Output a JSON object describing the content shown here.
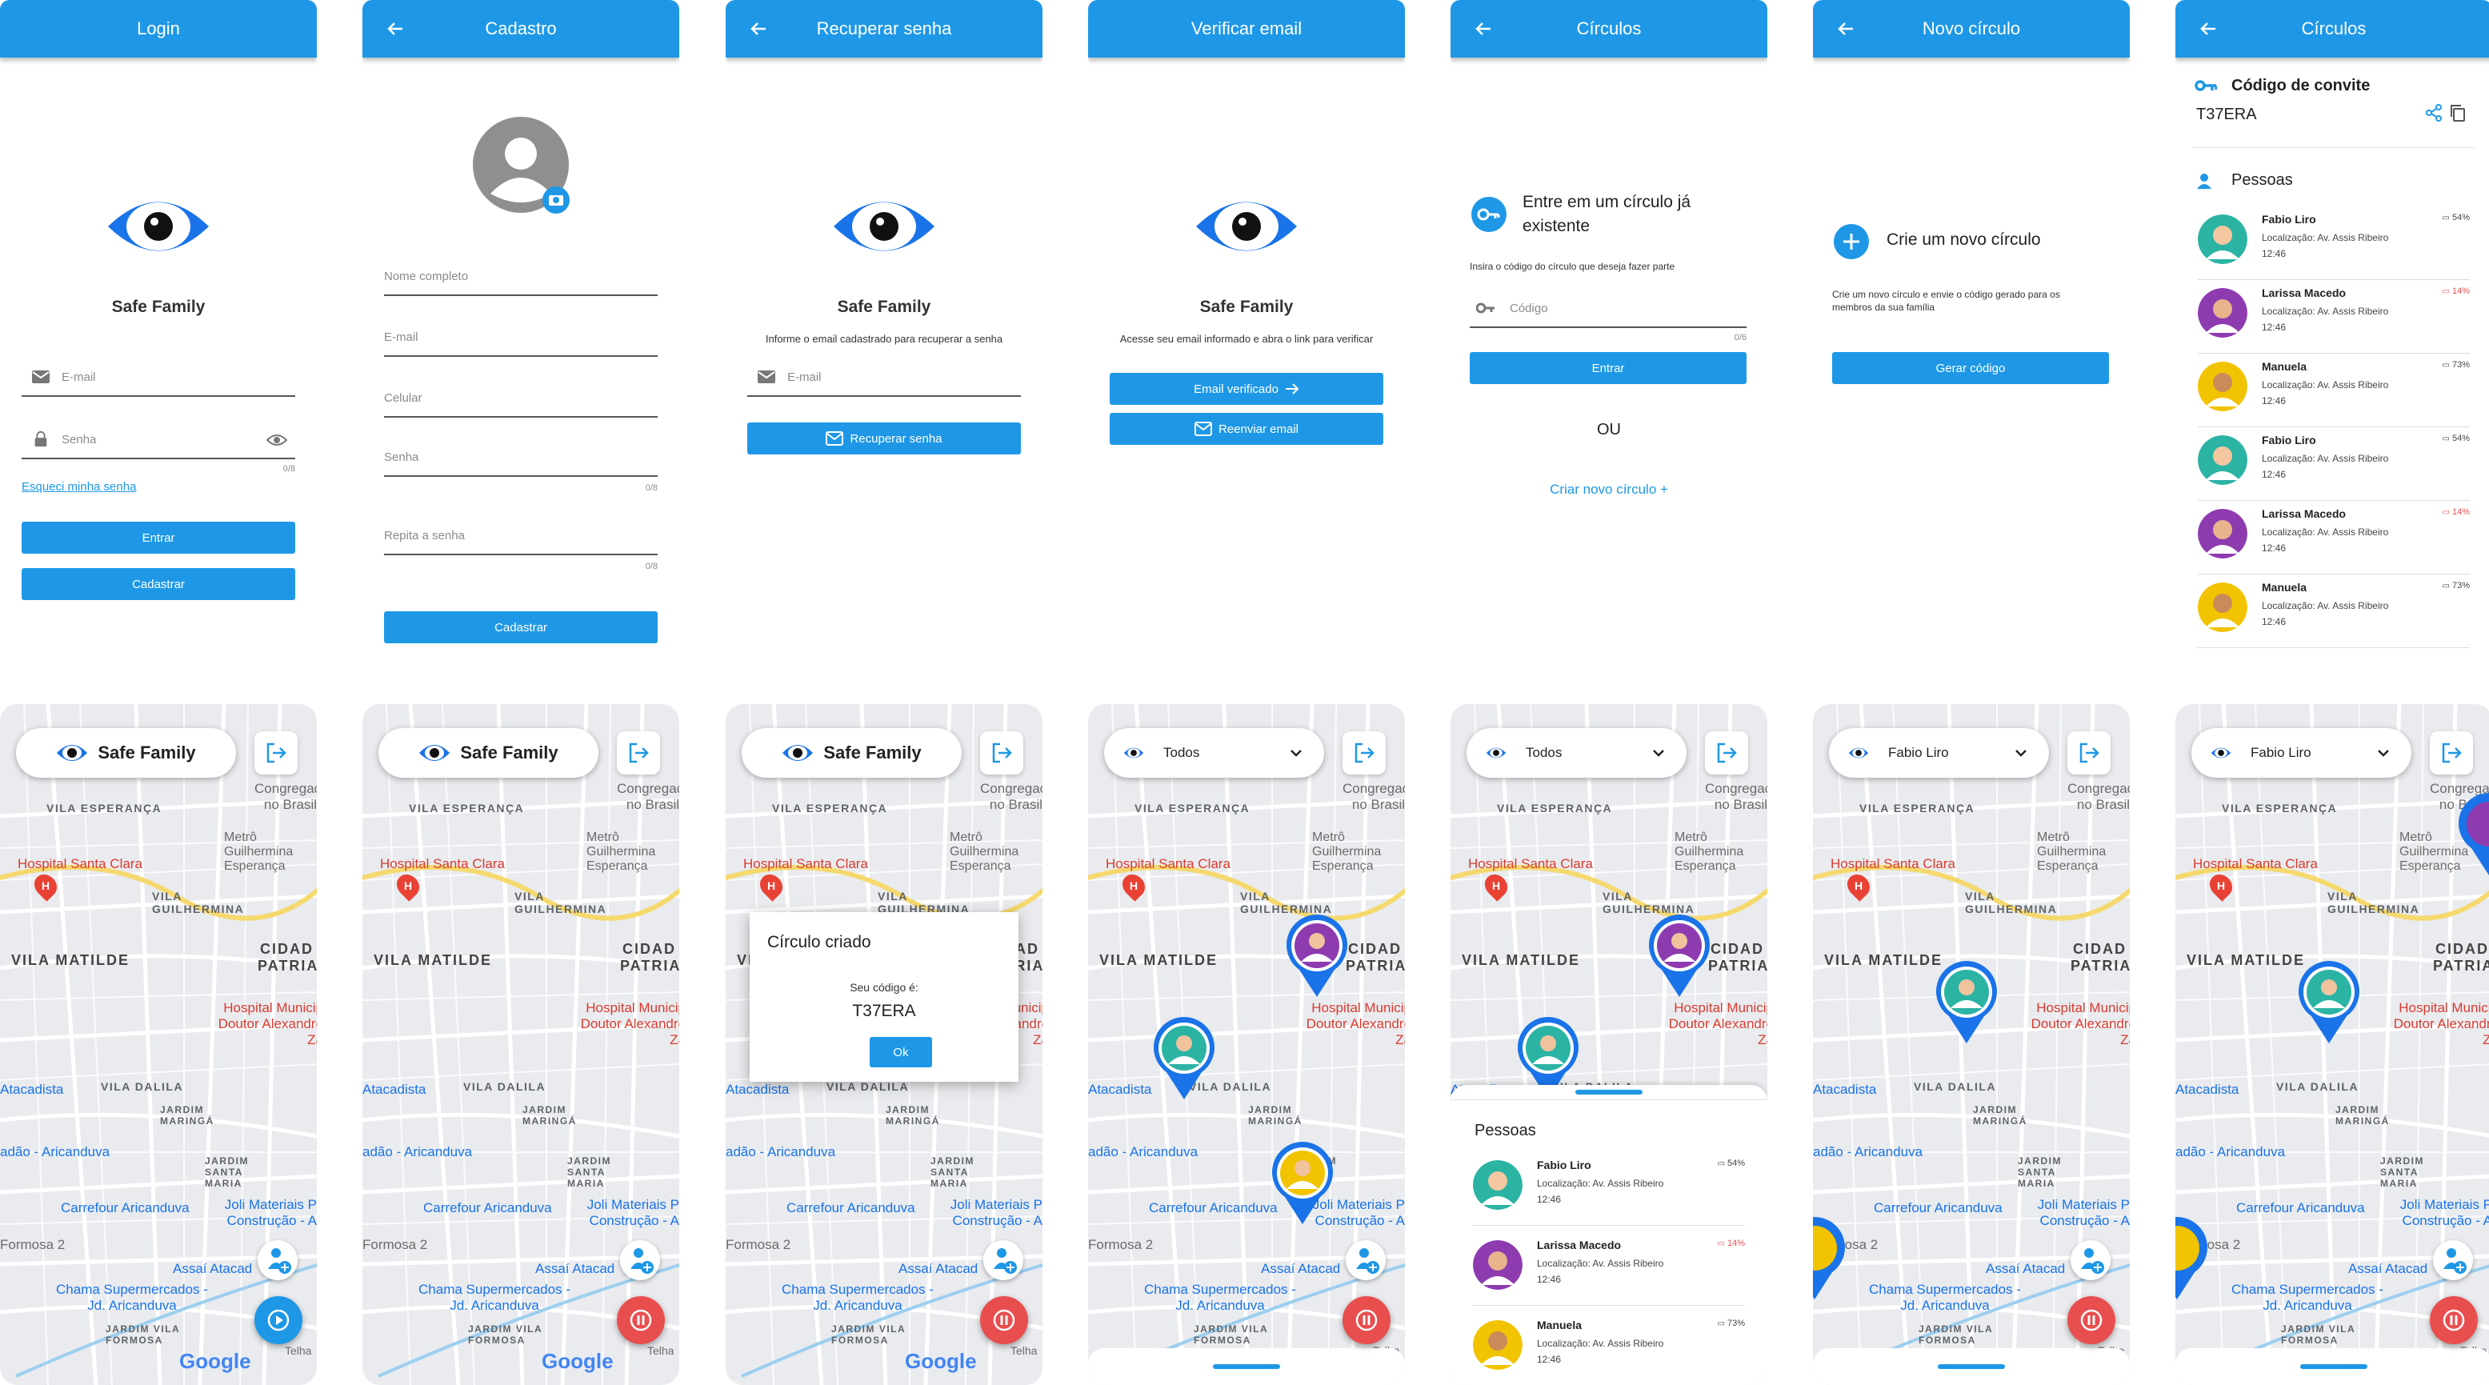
{
  "colors": {
    "primary": "#1e98e6",
    "danger": "#e94e4e",
    "map_bg": "#e9ebee"
  },
  "login": {
    "title": "Login",
    "app_name": "Safe Family",
    "email_placeholder": "E-mail",
    "password_placeholder": "Senha",
    "counter": "0/8",
    "forgot": "Esqueci minha senha",
    "enter": "Entrar",
    "register": "Cadastrar"
  },
  "register": {
    "title": "Cadastro",
    "name_placeholder": "Nome completo",
    "email_placeholder": "E-mail",
    "phone_placeholder": "Celular",
    "password_placeholder": "Senha",
    "repeat_placeholder": "Repita a senha",
    "counter": "0/8",
    "submit": "Cadastrar"
  },
  "recover": {
    "title": "Recuperar senha",
    "app_name": "Safe Family",
    "hint": "Informe o email cadastrado para recuperar a senha",
    "email_placeholder": "E-mail",
    "submit": "Recuperar senha"
  },
  "verify": {
    "title": "Verificar email",
    "app_name": "Safe Family",
    "hint": "Acesse seu email informado e abra o link para verificar",
    "verified": "Email verificado",
    "resend": "Reenviar email"
  },
  "circles_join": {
    "title": "Círculos",
    "join_title": "Entre em um círculo já existente",
    "hint": "Insira o código do círculo que deseja fazer parte",
    "code_placeholder": "Código",
    "counter": "0/6",
    "enter": "Entrar",
    "or": "OU",
    "create_link": "Criar novo círculo +"
  },
  "new_circle": {
    "title": "Novo círculo",
    "create_title": "Crie um novo círculo",
    "hint": "Crie um novo círculo e envie o código gerado para os membros da sua família",
    "generate": "Gerar código"
  },
  "circle_detail": {
    "title": "Círculos",
    "invite_label": "Código de convite",
    "invite_code": "T37ERA",
    "people_label": "Pessoas",
    "people": [
      {
        "name": "Fabio Liro",
        "loc": "Localização: Av. Assis Ribeiro",
        "time": "12:46",
        "battery": "54%"
      },
      {
        "name": "Larissa Macedo",
        "loc": "Localização: Av. Assis Ribeiro",
        "time": "12:46",
        "battery": "14%"
      },
      {
        "name": "Manuela",
        "loc": "Localização: Av. Assis Ribeiro",
        "time": "12:46",
        "battery": "73%"
      },
      {
        "name": "Fabio Liro",
        "loc": "Localização: Av. Assis Ribeiro",
        "time": "12:46",
        "battery": "54%"
      },
      {
        "name": "Larissa Macedo",
        "loc": "Localização: Av. Assis Ribeiro",
        "time": "12:46",
        "battery": "14%"
      },
      {
        "name": "Manuela",
        "loc": "Localização: Av. Assis Ribeiro",
        "time": "12:46",
        "battery": "73%"
      }
    ]
  },
  "map": {
    "app_name": "Safe Family",
    "filter_all": "Todos",
    "filter_person": "Fabio Liro",
    "labels": {
      "vila_esperanca": "VILA ESPERANÇA",
      "vila_guilhermina": "VILA GUILHERMINA",
      "vila_matilde": "VILA MATILDE",
      "cidade_patriarca": "CIDAD PATRIA",
      "vila_dalila": "VILA DALILA",
      "jardim_maringa": "JARDIM MARINGÁ",
      "jardim_santa_maria": "JARDIM SANTA MARIA",
      "jardim_vila_formosa": "JARDIM VILA FORMOSA",
      "metro": "Metrô Guilhermina Esperança",
      "hospital_santa_clara": "Hospital Santa Clara",
      "hospital_municipal": "Hospital Municip Doutor Alexandre Za",
      "carrefour": "Carrefour Aricanduva",
      "atacadista": "Atacadista",
      "aricanduva": "adão - Aricanduva",
      "joli": "Joli Materiais P Construção - A",
      "assai": "Assaí Atacad",
      "chama": "Chama Supermercados - Jd. Aricanduva",
      "formosa": "Formosa 2",
      "congregacao": "Congregaç no Brasil",
      "google": "Google",
      "telha": "Telha"
    },
    "dialog_title": "Círculo criado",
    "dialog_text": "Seu código é:",
    "dialog_code": "T37ERA",
    "dialog_ok": "Ok",
    "sheet_title": "Pessoas"
  }
}
